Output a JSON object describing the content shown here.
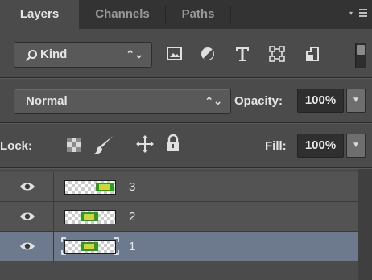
{
  "tabs": [
    {
      "label": "Layers",
      "active": true
    },
    {
      "label": "Channels",
      "active": false
    },
    {
      "label": "Paths",
      "active": false
    }
  ],
  "filter": {
    "kind_label": "Kind",
    "caret": "⌃⌄",
    "filters": [
      "pixel-layer-filter-icon",
      "adjustment-layer-filter-icon",
      "type-layer-filter-icon",
      "shape-layer-filter-icon",
      "smart-object-filter-icon"
    ]
  },
  "blend": {
    "mode": "Normal",
    "caret": "⌃⌄",
    "opacity_label": "Opacity:",
    "opacity_value": "100%"
  },
  "lock": {
    "label": "Lock:",
    "fill_label": "Fill:",
    "fill_value": "100%"
  },
  "layers": [
    {
      "name": "3",
      "selected": false,
      "visible": true
    },
    {
      "name": "2",
      "selected": false,
      "visible": true
    },
    {
      "name": "1",
      "selected": true,
      "visible": true
    }
  ],
  "colors": {
    "panel_bg": "#4b4b4b",
    "tabbar_bg": "#333333",
    "selected_row": "#6d7a8d",
    "layer_row": "#535353"
  }
}
